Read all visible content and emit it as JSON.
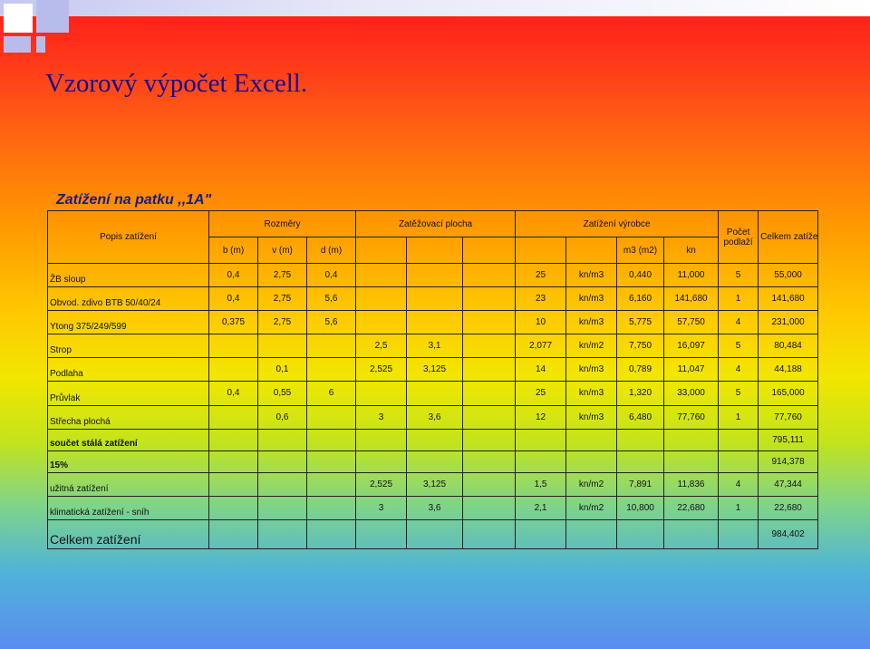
{
  "title": "Vzorový výpočet Excell.",
  "subtitle": "Zatížení na patku ,,1A\"",
  "header": {
    "popis": "Popis zatížení",
    "rozmery": "Rozměry",
    "zatezovaci": "Zatěžovací plocha",
    "vyrobce": "Zatížení výrobce",
    "pocet": "Počet podlaží",
    "celkem": "Celkem zatížení kn/m",
    "b": "b (m)",
    "v": "v (m)",
    "d": "d (m)",
    "m3m2": "m3 (m2)",
    "kn": "kn"
  },
  "rows": [
    {
      "label": "ŽB sloup",
      "c1": "0,4",
      "c2": "2,75",
      "c3": "0,4",
      "c4": "",
      "c5": "",
      "c6": "",
      "c7": "25",
      "c8": "kn/m3",
      "c9": "0,440",
      "c10": "11,000",
      "c11": "5",
      "c12": "55,000"
    },
    {
      "label": "Obvod. zdivo BTB 50/40/24",
      "c1": "0,4",
      "c2": "2,75",
      "c3": "5,6",
      "c4": "",
      "c5": "",
      "c6": "",
      "c7": "23",
      "c8": "kn/m3",
      "c9": "6,160",
      "c10": "141,680",
      "c11": "1",
      "c12": "141,680"
    },
    {
      "label": "Ytong 375/249/599",
      "c1": "0,375",
      "c2": "2,75",
      "c3": "5,6",
      "c4": "",
      "c5": "",
      "c6": "",
      "c7": "10",
      "c8": "kn/m3",
      "c9": "5,775",
      "c10": "57,750",
      "c11": "4",
      "c12": "231,000"
    },
    {
      "label": "Strop",
      "c1": "",
      "c2": "",
      "c3": "",
      "c4": "2,5",
      "c5": "3,1",
      "c6": "",
      "c7": "2,077",
      "c8": "kn/m2",
      "c9": "7,750",
      "c10": "16,097",
      "c11": "5",
      "c12": "80,484"
    },
    {
      "label": "Podlaha",
      "c1": "",
      "c2": "0,1",
      "c3": "",
      "c4": "2,525",
      "c5": "3,125",
      "c6": "",
      "c7": "14",
      "c8": "kn/m3",
      "c9": "0,789",
      "c10": "11,047",
      "c11": "4",
      "c12": "44,188"
    },
    {
      "label": "Průvlak",
      "c1": "0,4",
      "c2": "0,55",
      "c3": "6",
      "c4": "",
      "c5": "",
      "c6": "",
      "c7": "25",
      "c8": "kn/m3",
      "c9": "1,320",
      "c10": "33,000",
      "c11": "5",
      "c12": "165,000"
    },
    {
      "label": "Střecha plochá",
      "c1": "",
      "c2": "0,6",
      "c3": "",
      "c4": "3",
      "c5": "3,6",
      "c6": "",
      "c7": "12",
      "c8": "kn/m3",
      "c9": "6,480",
      "c10": "77,760",
      "c11": "1",
      "c12": "77,760"
    }
  ],
  "soucet": {
    "label": "součet stálá zatížení",
    "value": "795,111"
  },
  "procent": {
    "label": "15%",
    "value": "914,378"
  },
  "uzitna": {
    "label": "užitná zatížení",
    "c4": "2,525",
    "c5": "3,125",
    "c7": "1,5",
    "c8": "kn/m2",
    "c9": "7,891",
    "c10": "11,836",
    "c11": "4",
    "c12": "47,344"
  },
  "klimaticka": {
    "label": "klimatická zatížení - sníh",
    "c4": "3",
    "c5": "3,6",
    "c7": "2,1",
    "c8": "kn/m2",
    "c9": "10,800",
    "c10": "22,680",
    "c11": "1",
    "c12": "22,680"
  },
  "celkem": {
    "label": "Celkem zatížení",
    "value": "984,402"
  }
}
